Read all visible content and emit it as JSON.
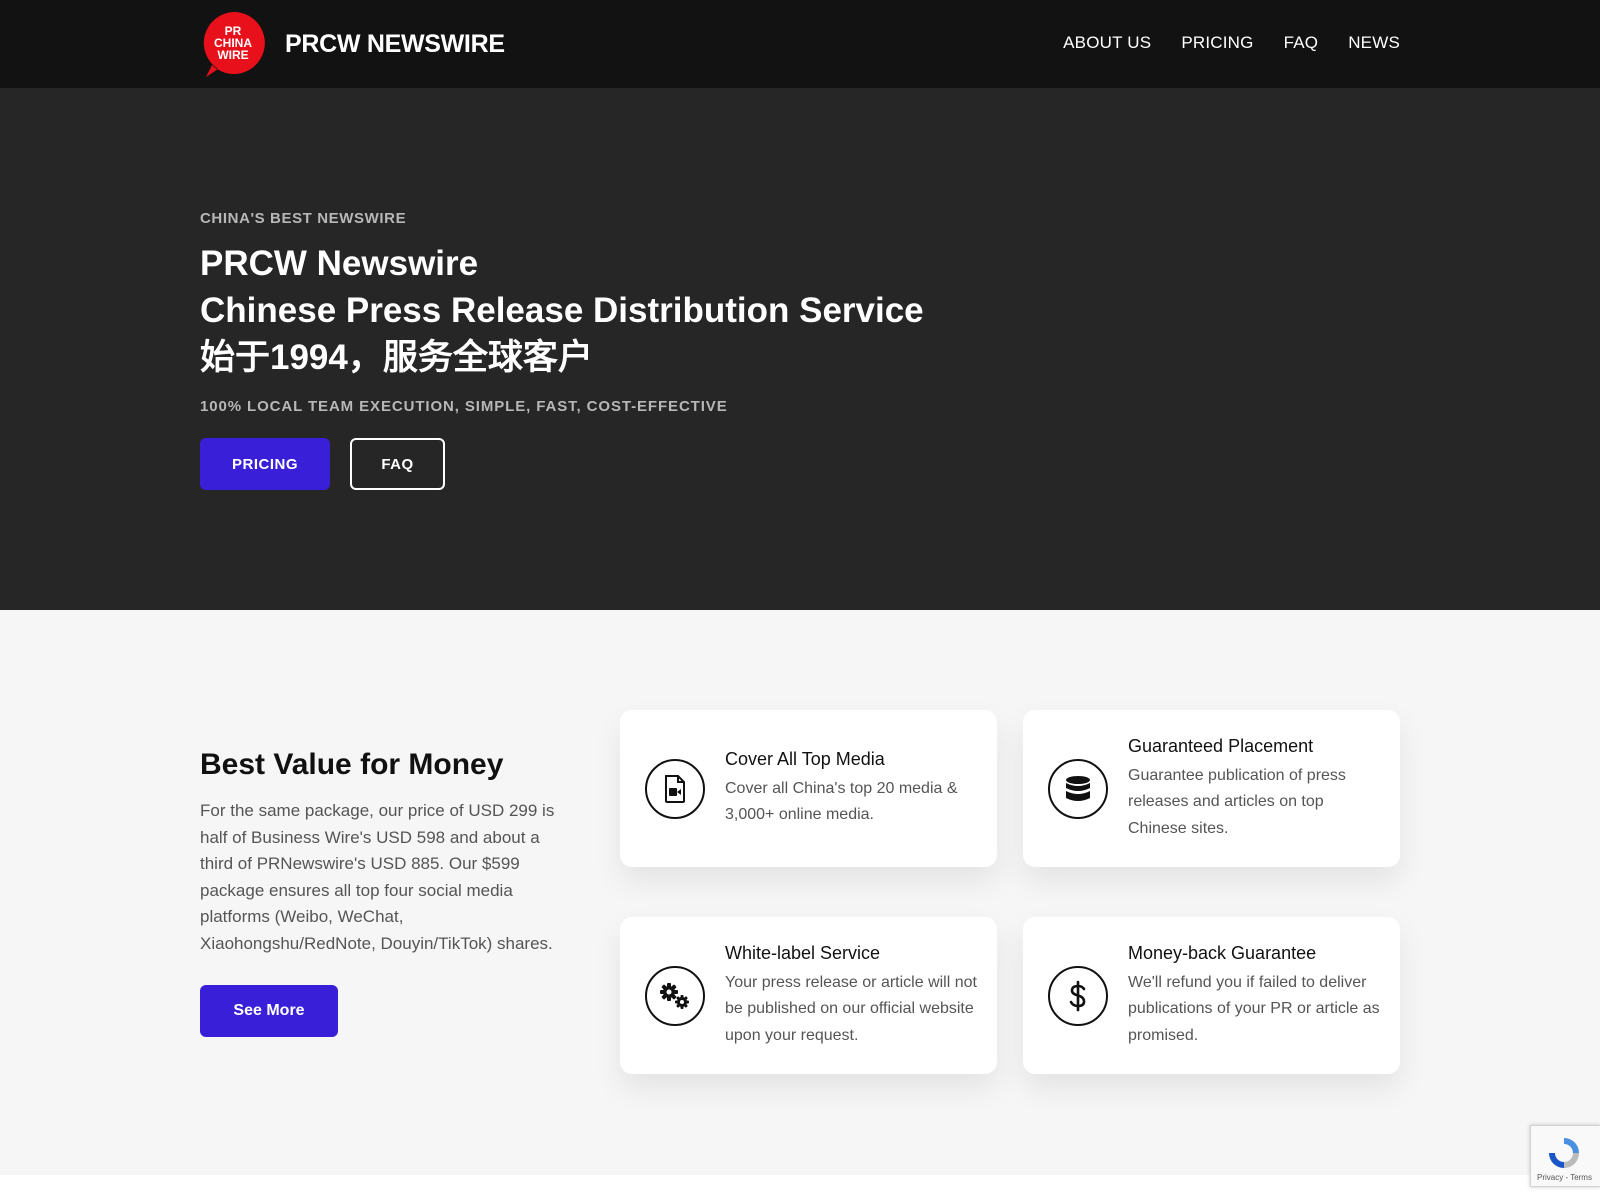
{
  "header": {
    "logo_lines": [
      "PR",
      "CHINA",
      "WIRE"
    ],
    "brand": "PRCW NEWSWIRE",
    "nav": [
      "ABOUT US",
      "PRICING",
      "FAQ",
      "NEWS"
    ]
  },
  "hero": {
    "eyebrow": "CHINA'S BEST NEWSWIRE",
    "title_lines": [
      "PRCW Newswire",
      "Chinese Press Release Distribution Service",
      "始于1994，服务全球客户"
    ],
    "subline": "100% LOCAL TEAM EXECUTION, SIMPLE, FAST, COST-EFFECTIVE",
    "pricing_label": "PRICING",
    "faq_label": "FAQ"
  },
  "features": {
    "title": "Best Value for Money",
    "text": "For the same package, our price of USD 299 is half of Business Wire's USD 598 and about a third of PRNewswire's USD 885. Our $599 package ensures all top four social media platforms (Weibo, WeChat, Xiaohongshu/RedNote, Douyin/TikTok) shares.",
    "see_more_label": "See More",
    "cards": [
      {
        "icon": "video-file-icon",
        "title": "Cover All Top Media",
        "text": "Cover all China's top 20 media & 3,000+ online media."
      },
      {
        "icon": "database-icon",
        "title": "Guaranteed Placement",
        "text": "Guarantee publication of press releases and articles on top Chinese sites."
      },
      {
        "icon": "gears-icon",
        "title": "White-label Service",
        "text": "Your press release or article will not be published on our official website upon your request."
      },
      {
        "icon": "dollar-icon",
        "title": "Money-back Guarantee",
        "text": "We'll refund you if failed to deliver publications of your PR or article as promised."
      }
    ]
  },
  "recaptcha": {
    "text": "Privacy - Terms"
  },
  "colors": {
    "accent": "#3a1fd9",
    "header_bg": "#121212",
    "hero_bg": "#262626",
    "logo_red": "#e8101b"
  }
}
